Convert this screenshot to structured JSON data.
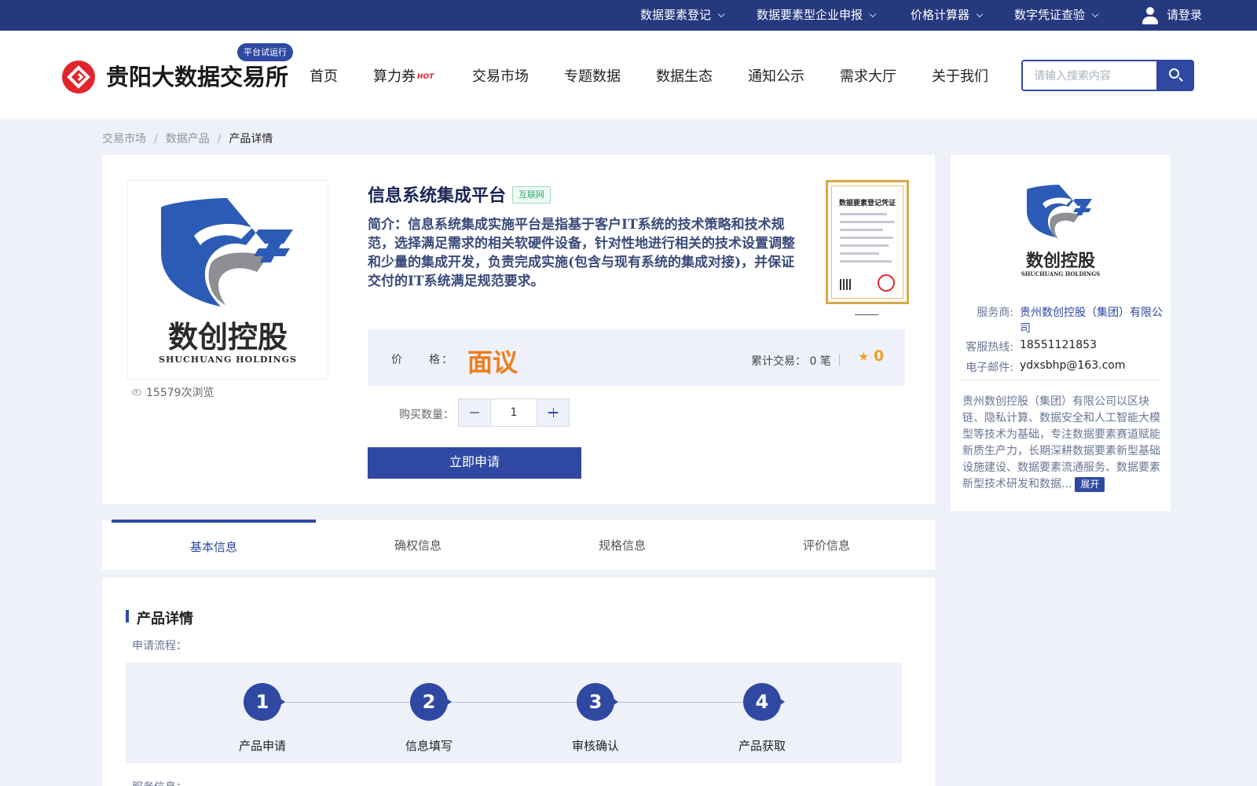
{
  "topbar": {
    "items": [
      {
        "label": "数据要素登记"
      },
      {
        "label": "数据要素型企业申报"
      },
      {
        "label": "价格计算器"
      },
      {
        "label": "数字凭证查验"
      }
    ],
    "login_label": "请登录"
  },
  "header": {
    "site_title": "贵阳大数据交易所",
    "trial_badge": "平台试运行",
    "nav": [
      {
        "label": "首页"
      },
      {
        "label": "算力券",
        "badge": "HOT"
      },
      {
        "label": "交易市场"
      },
      {
        "label": "专题数据"
      },
      {
        "label": "数据生态"
      },
      {
        "label": "通知公示"
      },
      {
        "label": "需求大厅"
      },
      {
        "label": "关于我们"
      }
    ],
    "search_placeholder": "请输入搜索内容"
  },
  "breadcrumb": [
    "交易市场",
    "数据产品",
    "产品详情"
  ],
  "product": {
    "logo_cn": "数创控股",
    "logo_en": "SHUCHUANG HOLDINGS",
    "views": "15579次浏览",
    "title": "信息系统集成平台",
    "tag": "互联网",
    "intro": "简介：信息系统集成实施平台是指基于客户IT系统的技术策略和技术规范，选择满足需求的相关软硬件设备，针对性地进行相关的技术设置调整和少量的集成开发，负责完成实施(包含与现有系统的集成对接)，并保证交付的IT系统满足规范要求。",
    "cert_title": "数据要素登记凭证",
    "price_label": "价　　格：",
    "price_value": "面议",
    "trades": "累计交易：  0 笔",
    "rating": "0",
    "qty_label": "购买数量：",
    "qty_value": "1",
    "apply_label": "立即申请"
  },
  "provider": {
    "logo_cn": "数创控股",
    "logo_en": "SHUCHUANG HOLDINGS",
    "service_label": "服务商:",
    "service_value_1": "贵州数创控股（集团）有限公",
    "service_value_2": "司",
    "hotline_label": "客服热线:",
    "hotline_value": "18551121853",
    "email_label": "电子邮件:",
    "email_value": "ydxsbhp@163.com",
    "description": "贵州数创控股（集团）有限公司以区块链、隐私计算、数据安全和人工智能大模型等技术为基础，专注数据要素赛道赋能新质生产力，长期深耕数据要素新型基础设施建设、数据要素流通服务、数据要素新型技术研发和数据...",
    "expand_label": "展开"
  },
  "tabs": [
    {
      "label": "基本信息"
    },
    {
      "label": "确权信息"
    },
    {
      "label": "规格信息"
    },
    {
      "label": "评价信息"
    }
  ],
  "details": {
    "section_title": "产品详情",
    "flow_label": "申请流程：",
    "steps": [
      {
        "num": "1",
        "label": "产品申请"
      },
      {
        "num": "2",
        "label": "信息填写"
      },
      {
        "num": "3",
        "label": "审核确认"
      },
      {
        "num": "4",
        "label": "产品获取"
      }
    ],
    "service_label": "服务信息："
  },
  "colors": {
    "primary": "#2f49a3",
    "topbar": "#25397e",
    "accent_orange": "#f07e1a",
    "brand_red": "#e0252c"
  }
}
